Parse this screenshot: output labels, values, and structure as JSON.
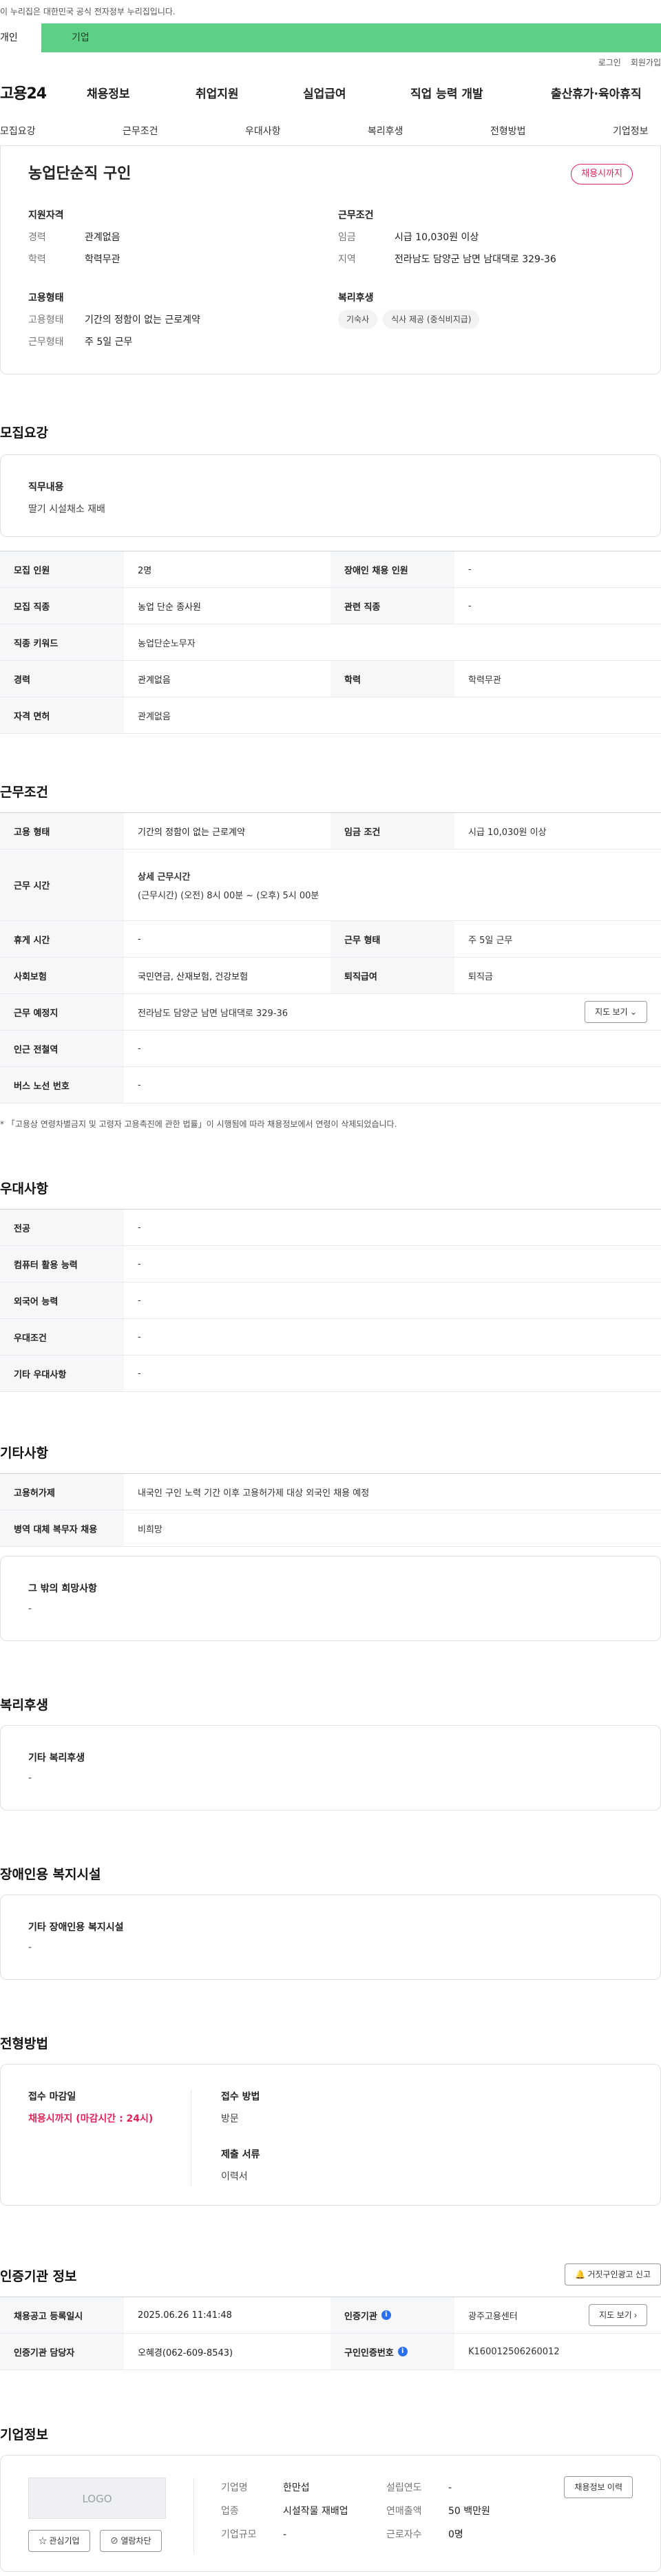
{
  "gov_bar": "이 누리집은 대한민국 공식 전자정부 누리집입니다.",
  "site_tabs": {
    "personal": "개인",
    "company": "기업"
  },
  "util": {
    "login": "로그인",
    "join": "회원가입"
  },
  "gnb": {
    "logo": "고용24",
    "menus": [
      "채용정보",
      "취업지원",
      "실업급여",
      "직업 능력 개발",
      "출산휴가·육아휴직"
    ]
  },
  "anchors": [
    "모집요강",
    "근무조건",
    "우대사항",
    "복리후생",
    "전형방법",
    "기업정보"
  ],
  "summary": {
    "title": "농업단순직 구인",
    "badge": "채용시까지",
    "qualification": {
      "heading": "지원자격",
      "career_k": "경력",
      "career_v": "관계없음",
      "edu_k": "학력",
      "edu_v": "학력무관"
    },
    "employment": {
      "heading": "고용형태",
      "type_k": "고용형태",
      "type_v": "기간의 정함이 없는 근로계약",
      "work_k": "근무형태",
      "work_v": "주 5일 근무"
    },
    "conditions": {
      "heading": "근무조건",
      "wage_k": "임금",
      "wage_v": "시급 10,030원 이상",
      "region_k": "지역",
      "region_v": "전라남도 담양군 남면 남대댁로 329-36"
    },
    "welfare": {
      "heading": "복리후생",
      "chips": [
        "기숙사",
        "식사 제공 (중식비지급)"
      ]
    }
  },
  "recruit": {
    "heading": "모집요강",
    "job_title": "직무내용",
    "job_desc": "딸기 시설채소 재배",
    "rows": {
      "count_k": "모집 인원",
      "count_v": "2명",
      "disabled_k": "장애인 채용 인원",
      "disabled_v": "-",
      "job_k": "모집 직종",
      "job_v": "농업 단순 종사원",
      "related_k": "관련 직종",
      "related_v": "-",
      "keyword_k": "직종 키워드",
      "keyword_v": "농업단순노무자",
      "career_k": "경력",
      "career_v": "관계없음",
      "edu_k": "학력",
      "edu_v": "학력무관",
      "license_k": "자격 면허",
      "license_v": "관계없음"
    }
  },
  "work": {
    "heading": "근무조건",
    "type_k": "고용 형태",
    "type_v": "기간의 정함이 없는 근로계약",
    "wage_k": "임금 조건",
    "wage_v": "시급 10,030원 이상",
    "time_k": "근무 시간",
    "time_title": "상세 근무시간",
    "time_v": "(근무시간) (오전) 8시 00분 ~ (오후) 5시 00분",
    "rest_k": "휴게 시간",
    "rest_v": "-",
    "form_k": "근무 형태",
    "form_v": "주 5일 근무",
    "insurance_k": "사회보험",
    "insurance_v": "국민연금, 산재보험, 건강보험",
    "retire_k": "퇴직급여",
    "retire_v": "퇴직금",
    "place_k": "근무 예정지",
    "place_v": "전라남도 담양군 남면 남대댁로 329-36",
    "map_btn": "지도 보기",
    "subway_k": "인근 전철역",
    "subway_v": "-",
    "bus_k": "버스 노선 번호",
    "bus_v": "-",
    "note": "* 「고용상 연령차별금지 및 고령자 고용촉진에 관한 법률」이 시행됨에 따라 채용정보에서 연령이 삭제되었습니다."
  },
  "prefer": {
    "heading": "우대사항",
    "rows": [
      {
        "k": "전공",
        "v": "-"
      },
      {
        "k": "컴퓨터 활용 능력",
        "v": "-"
      },
      {
        "k": "외국어 능력",
        "v": "-"
      },
      {
        "k": "우대조건",
        "v": "-"
      },
      {
        "k": "기타 우대사항",
        "v": "-"
      }
    ]
  },
  "etc": {
    "heading": "기타사항",
    "rows": [
      {
        "k": "고용허가제",
        "v": "내국인 구인 노력 기간 이후 고용허가제 대상 외국인 채용 예정"
      },
      {
        "k": "병역 대체 복무자 채용",
        "v": "비희망"
      }
    ],
    "other_title": "그 밖의 희망사항",
    "other_v": "-"
  },
  "welfare": {
    "heading": "복리후생",
    "title": "기타 복리후생",
    "value": "-"
  },
  "disabled": {
    "heading": "장애인용 복지시설",
    "title": "기타 장애인용 복지시설",
    "value": "-"
  },
  "selection": {
    "heading": "전형방법",
    "deadline_title": "접수 마감일",
    "deadline_v": "채용시까지 (마감시간 : 24시)",
    "method_title": "접수 방법",
    "method_v": "방문",
    "docs_title": "제출 서류",
    "docs_v": "이력서"
  },
  "cert": {
    "heading": "인증기관 정보",
    "report_btn": "거짓구인광고 신고",
    "reg_k": "채용공고 등록일시",
    "reg_v": "2025.06.26 11:41:48",
    "agency_k": "인증기관",
    "agency_v": "광주고용센터",
    "map_btn": "지도 보기",
    "manager_k": "인증기관 담당자",
    "manager_v": "오혜경(062-609-8543)",
    "no_k": "구인인증번호",
    "no_v": "K160012506260012"
  },
  "company": {
    "heading": "기업정보",
    "logo": "LOGO",
    "fav_btn": "관심기업",
    "block_btn": "열람차단",
    "name_k": "기업명",
    "name_v": "한만섭",
    "industry_k": "업종",
    "industry_v": "시설작물 재배업",
    "size_k": "기업규모",
    "size_v": "-",
    "founded_k": "설립연도",
    "founded_v": "-",
    "sales_k": "연매출액",
    "sales_v": "50 백만원",
    "staff_k": "근로자수",
    "staff_v": "0명",
    "history_btn": "채용정보 이력"
  },
  "colors": {
    "accent_green": "#5ed085",
    "badge_red": "#e3245a",
    "info_blue": "#2b6ff2"
  }
}
